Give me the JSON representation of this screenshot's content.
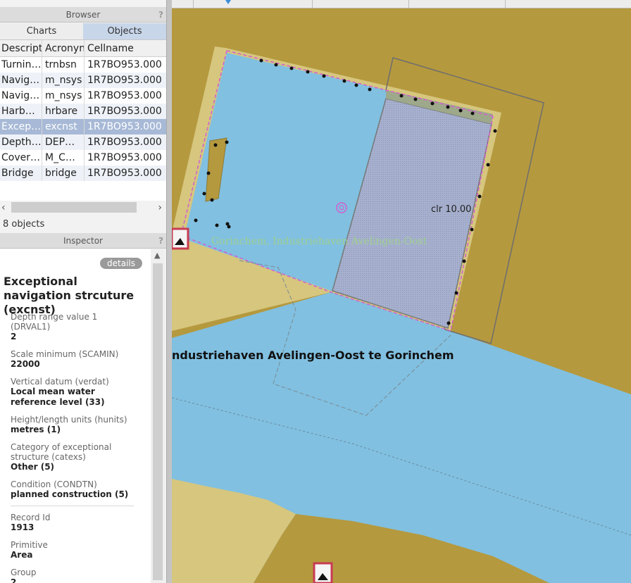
{
  "browser": {
    "title": "Browser",
    "help": "?",
    "tabs": [
      "Charts",
      "Objects"
    ],
    "columns": [
      "Descript",
      "Acronyn",
      "Cellname"
    ],
    "rows": [
      {
        "desc": "Turnin…",
        "acr": "trnbsn",
        "cell": "1R7BO953.000"
      },
      {
        "desc": "Navig…",
        "acr": "m_nsys",
        "cell": "1R7BO953.000"
      },
      {
        "desc": "Navig…",
        "acr": "m_nsys",
        "cell": "1R7BO953.000"
      },
      {
        "desc": "Harb…",
        "acr": "hrbare",
        "cell": "1R7BO953.000"
      },
      {
        "desc": "Excep…",
        "acr": "excnst",
        "cell": "1R7BO953.000"
      },
      {
        "desc": "Depth…",
        "acr": "DEP…",
        "cell": "1R7BO953.000"
      },
      {
        "desc": "Cover…",
        "acr": "M_C…",
        "cell": "1R7BO953.000"
      },
      {
        "desc": "Bridge",
        "acr": "bridge",
        "cell": "1R7BO953.000"
      }
    ],
    "selected_row": 4,
    "count": "8 objects"
  },
  "inspector": {
    "title": "Inspector",
    "help": "?",
    "details_label": "details",
    "object_title": "Exceptional navigation strcuture (excnst)",
    "fields": [
      {
        "label": "Depth range value 1 (DRVAL1)",
        "value": "2"
      },
      {
        "label": "Scale minimum (SCAMIN)",
        "value": "22000"
      },
      {
        "label": "Vertical datum (verdat)",
        "value": "Local mean water reference level (33)"
      },
      {
        "label": "Height/length units (hunits)",
        "value": "metres (1)"
      },
      {
        "label": "Category of exceptional structure (catexs)",
        "value": "Other (5)"
      },
      {
        "label": "Condition (CONDTN)",
        "value": "planned construction (5)"
      },
      {
        "label": "Record Id",
        "value": "1913"
      },
      {
        "label": "Primitive",
        "value": "Area"
      },
      {
        "label": "Group",
        "value": "2"
      }
    ]
  },
  "map": {
    "label_green": "Gorinchem, Industriehaven Avelingen-Oost",
    "label_black": "ndustriehaven Avelingen-Oost te Gorinchem",
    "label_clr": "clr 10.00",
    "colors": {
      "land": "#b5993e",
      "water": "#81c0e0",
      "shore": "#d6c67e",
      "structure": "#a8b2cf",
      "magenta": "#d15fd1",
      "label_green": "#9fcf8f"
    }
  }
}
